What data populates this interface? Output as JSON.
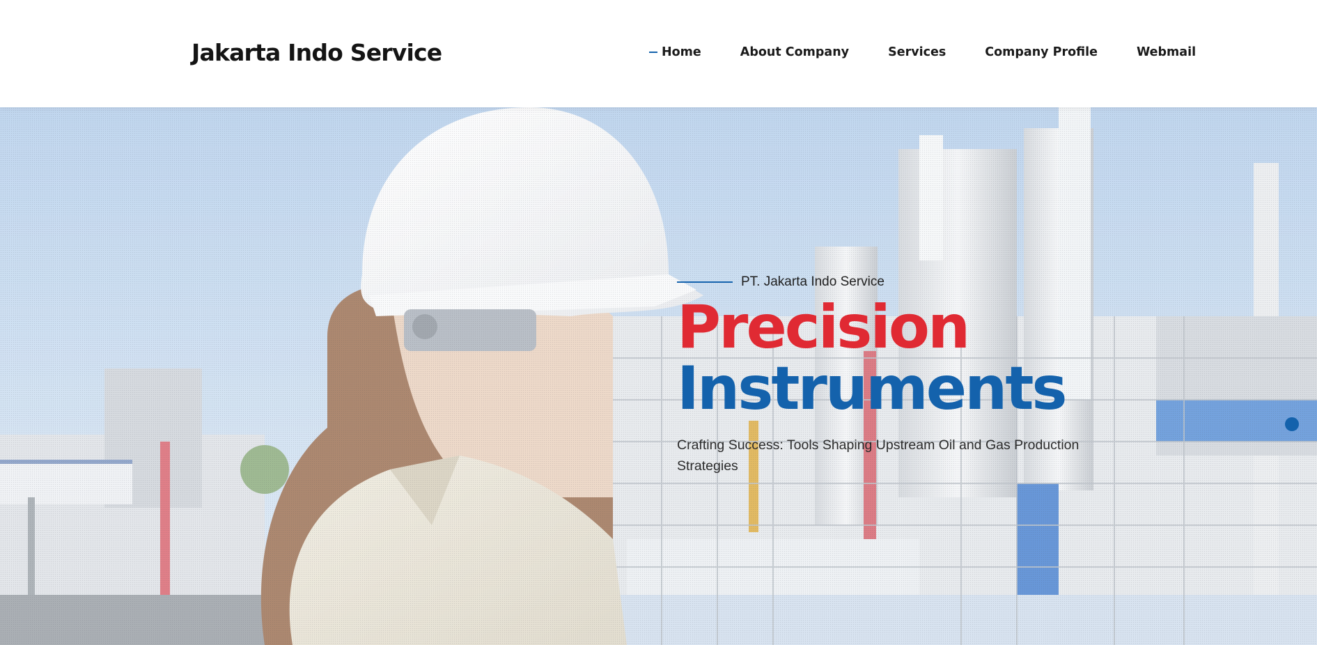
{
  "header": {
    "brand": "Jakarta Indo Service",
    "nav": [
      {
        "label": "Home",
        "active": true
      },
      {
        "label": "About Company",
        "active": false
      },
      {
        "label": "Services",
        "active": false
      },
      {
        "label": "Company Profile",
        "active": false
      },
      {
        "label": "Webmail",
        "active": false
      }
    ]
  },
  "hero": {
    "eyebrow": "PT. Jakarta Indo Service",
    "headline_line1": "Precision",
    "headline_line2": "Instruments",
    "subtitle": "Crafting Success: Tools Shaping Upstream Oil and Gas Production Strategies",
    "slide_count_visible": 1
  },
  "colors": {
    "accent_blue": "#1462ac",
    "accent_red": "#e02a33",
    "sky": "#b9d4ee"
  }
}
